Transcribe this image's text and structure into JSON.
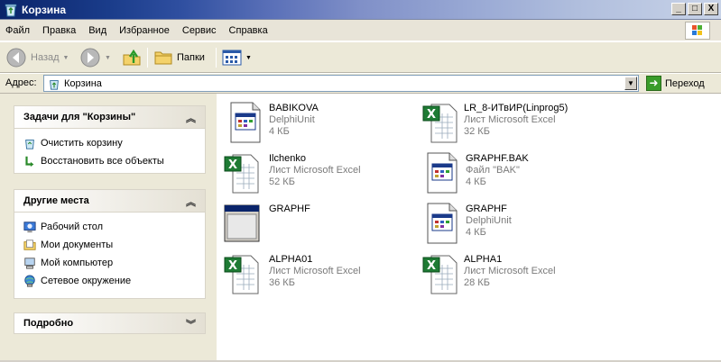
{
  "window": {
    "title": "Корзина",
    "minimize": "_",
    "maximize": "□",
    "close": "X"
  },
  "menu": {
    "items": [
      "Файл",
      "Правка",
      "Вид",
      "Избранное",
      "Сервис",
      "Справка"
    ]
  },
  "toolbar": {
    "back_label": "Назад",
    "folders_label": "Папки",
    "icons": {
      "back": "back-arrow-icon",
      "forward": "forward-arrow-icon",
      "up": "folder-up-icon",
      "folders": "folders-icon",
      "views": "views-icon"
    }
  },
  "address": {
    "label": "Адрес:",
    "value": "Корзина",
    "go_label": "Переход"
  },
  "panels": {
    "tasks": {
      "title": "Задачи для \"Корзины\"",
      "items": [
        "Очистить корзину",
        "Восстановить все объекты"
      ]
    },
    "places": {
      "title": "Другие места",
      "items": [
        "Рабочий стол",
        "Мои документы",
        "Мой компьютер",
        "Сетевое окружение"
      ]
    },
    "details": {
      "title": "Подробно"
    }
  },
  "files": [
    {
      "name": "BABIKOVA",
      "type": "DelphiUnit",
      "size": "4 КБ",
      "icon": "delphi-unit-icon"
    },
    {
      "name": "LR_8-ИТвИР(Linprog5)",
      "type": "Лист Microsoft Excel",
      "size": "32 КБ",
      "icon": "excel-icon"
    },
    {
      "name": "Ilchenko",
      "type": "Лист Microsoft Excel",
      "size": "52 КБ",
      "icon": "excel-icon"
    },
    {
      "name": "GRAPHF.BAK",
      "type": "Файл \"BAK\"",
      "size": "4 КБ",
      "icon": "bak-file-icon"
    },
    {
      "name": "GRAPHF",
      "type": "",
      "size": "",
      "icon": "application-window-icon"
    },
    {
      "name": "GRAPHF",
      "type": "DelphiUnit",
      "size": "4 КБ",
      "icon": "delphi-unit-icon"
    },
    {
      "name": "ALPHA01",
      "type": "Лист Microsoft Excel",
      "size": "36 КБ",
      "icon": "excel-icon"
    },
    {
      "name": "ALPHA1",
      "type": "Лист Microsoft Excel",
      "size": "28 КБ",
      "icon": "excel-icon"
    }
  ],
  "colors": {
    "title_gradient_start": "#0a246a",
    "panel_bg": "#ece9d8",
    "excel_green": "#1e7b34",
    "subtext_gray": "#7a7a7a"
  }
}
